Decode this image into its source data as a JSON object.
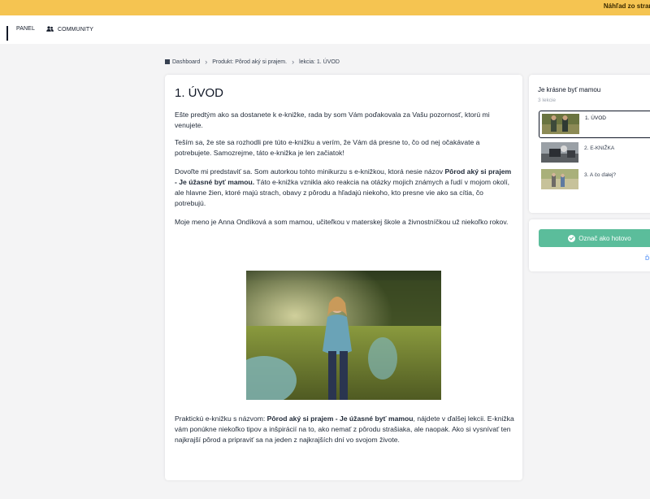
{
  "banner": {
    "text": "Náhľad zo strany z"
  },
  "nav": {
    "panel_label": "PANEL",
    "community_label": "COMMUNITY"
  },
  "breadcrumb": {
    "items": [
      "Dashboard",
      "Produkt: Pôrod aký si prajem.",
      "lekcia: 1. ÚVOD"
    ]
  },
  "lesson": {
    "title": "1. ÚVOD",
    "paragraphs": [
      "Ešte predtým ako sa dostanete k e-knižke, rada by som Vám poďakovala za Vašu pozornosť, ktorú mi venujete.",
      "Teším sa, že ste sa rozhodli pre túto e-knižku a verím, že Vám dá presne to, čo od nej očakávate a potrebujete. Samozrejme, táto e-knižka je len začiatok!",
      "Moje meno je Anna Ondíková a som mamou, učiteľkou v materskej škole a živnostníčkou už niekoľko rokov."
    ],
    "intro_p3": {
      "before": "Dovoľte mi predstaviť sa. Som autorkou tohto minikurzu s e-knižkou, ktorá nesie názov ",
      "bold": "Pôrod aký si prajem - Je úžasné byť mamou.",
      "after": " Táto e-knižka vznikla ako reakcia na otázky mojich známych a ľudí v mojom okolí, ale hlavne žien, ktoré majú strach, obavy z pôrodu a hľadajú niekoho, kto presne vie ako sa cítia, čo potrebujú."
    },
    "closing": {
      "before": "Praktickú e-knižku s názvom: ",
      "bold": "Pôrod aký si prajem - Je úžasné byť mamou",
      "after": ", nájdete v ďalšej lekcii. E-knižka vám ponúkne niekoľko tipov a inšpirácií na to, ako nemať z pôrodu strašiaka, ale naopak. Ako si vysnívať ten najkrajší pôrod a pripraviť sa na jeden z najkrajších dní vo svojom živote."
    }
  },
  "sidebar": {
    "course_title": "Je krásne byť mamou",
    "lesson_count": "3 lekcie",
    "lessons": [
      {
        "label": "1. ÚVOD"
      },
      {
        "label": "2. E-KNIŽKA"
      },
      {
        "label": "3. A čo ďalej?"
      }
    ]
  },
  "actions": {
    "done_label": "Označ ako hotovo",
    "next_label": "Ď",
    "accent_color": "#5bbd9b"
  }
}
